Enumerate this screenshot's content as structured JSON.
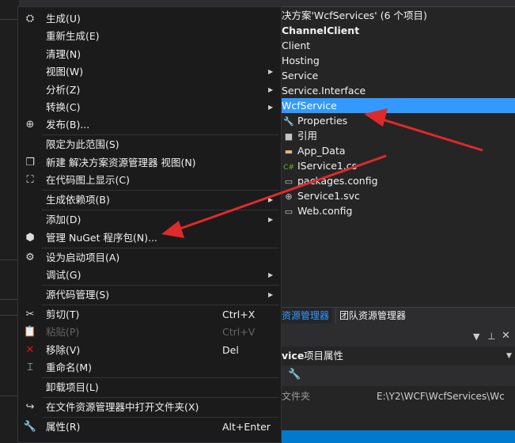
{
  "solution_explorer": {
    "items": [
      {
        "text": "决方案'WcfServices' (6 个项目)",
        "icon": "",
        "bold": false,
        "selected": false,
        "indent": 52
      },
      {
        "text": "ChannelClient",
        "icon": "",
        "bold": true,
        "selected": false,
        "indent": 52
      },
      {
        "text": "Client",
        "icon": "",
        "bold": false,
        "selected": false,
        "indent": 52
      },
      {
        "text": "Hosting",
        "icon": "",
        "bold": false,
        "selected": false,
        "indent": 52
      },
      {
        "text": "Service",
        "icon": "",
        "bold": false,
        "selected": false,
        "indent": 52
      },
      {
        "text": "Service.Interface",
        "icon": "",
        "bold": false,
        "selected": false,
        "indent": 52
      },
      {
        "text": "WcfService",
        "icon": "",
        "bold": false,
        "selected": true,
        "indent": 52
      },
      {
        "text": "Properties",
        "icon": "wrench-icon",
        "bold": false,
        "selected": false,
        "indent": 52
      },
      {
        "text": "引用",
        "icon": "references-icon",
        "bold": false,
        "selected": false,
        "indent": 52
      },
      {
        "text": "App_Data",
        "icon": "folder-icon",
        "bold": false,
        "selected": false,
        "indent": 52
      },
      {
        "text": "IService1.cs",
        "icon": "csharp-file-icon",
        "bold": false,
        "selected": false,
        "indent": 52
      },
      {
        "text": "packages.config",
        "icon": "config-file-icon",
        "bold": false,
        "selected": false,
        "indent": 52
      },
      {
        "text": "Service1.svc",
        "icon": "globe-icon",
        "bold": false,
        "selected": false,
        "indent": 52
      },
      {
        "text": "Web.config",
        "icon": "config-file-icon",
        "bold": false,
        "selected": false,
        "indent": 52
      }
    ],
    "tabs": {
      "active": "资源管理器",
      "inactive": "团队资源管理器"
    }
  },
  "properties": {
    "title_prefix": "vice",
    "title_suffix": "项目属性",
    "row_label": "文件夹",
    "row_value": "E:\\Y2\\WCF\\WcfServices\\Wc"
  },
  "menu": {
    "items": [
      {
        "label": "生成(U)",
        "icon": "build-icon",
        "shortcut": "",
        "submenu": false,
        "disabled": false,
        "sep_after": false
      },
      {
        "label": "重新生成(E)",
        "icon": "",
        "shortcut": "",
        "submenu": false,
        "disabled": false,
        "sep_after": false
      },
      {
        "label": "清理(N)",
        "icon": "",
        "shortcut": "",
        "submenu": false,
        "disabled": false,
        "sep_after": false
      },
      {
        "label": "视图(W)",
        "icon": "",
        "shortcut": "",
        "submenu": true,
        "disabled": false,
        "sep_after": false
      },
      {
        "label": "分析(Z)",
        "icon": "",
        "shortcut": "",
        "submenu": true,
        "disabled": false,
        "sep_after": false
      },
      {
        "label": "转换(C)",
        "icon": "",
        "shortcut": "",
        "submenu": true,
        "disabled": false,
        "sep_after": false
      },
      {
        "label": "发布(B)...",
        "icon": "publish-globe-icon",
        "shortcut": "",
        "submenu": false,
        "disabled": false,
        "sep_after": true
      },
      {
        "label": "限定为此范围(S)",
        "icon": "",
        "shortcut": "",
        "submenu": false,
        "disabled": false,
        "sep_after": false
      },
      {
        "label": "新建 解决方案资源管理器 视图(N)",
        "icon": "new-view-icon",
        "shortcut": "",
        "submenu": false,
        "disabled": false,
        "sep_after": false
      },
      {
        "label": "在代码图上显示(C)",
        "icon": "code-map-icon",
        "shortcut": "",
        "submenu": false,
        "disabled": false,
        "sep_after": true
      },
      {
        "label": "生成依赖项(B)",
        "icon": "",
        "shortcut": "",
        "submenu": true,
        "disabled": false,
        "sep_after": true
      },
      {
        "label": "添加(D)",
        "icon": "",
        "shortcut": "",
        "submenu": true,
        "disabled": false,
        "sep_after": false
      },
      {
        "label": "管理 NuGet 程序包(N)...",
        "icon": "nuget-icon",
        "shortcut": "",
        "submenu": false,
        "disabled": false,
        "sep_after": true
      },
      {
        "label": "设为启动项目(A)",
        "icon": "gear-icon",
        "shortcut": "",
        "submenu": false,
        "disabled": false,
        "sep_after": false
      },
      {
        "label": "调试(G)",
        "icon": "",
        "shortcut": "",
        "submenu": true,
        "disabled": false,
        "sep_after": true
      },
      {
        "label": "源代码管理(S)",
        "icon": "",
        "shortcut": "",
        "submenu": true,
        "disabled": false,
        "sep_after": true
      },
      {
        "label": "剪切(T)",
        "icon": "scissors-icon",
        "shortcut": "Ctrl+X",
        "submenu": false,
        "disabled": false,
        "sep_after": false
      },
      {
        "label": "粘贴(P)",
        "icon": "paste-icon",
        "shortcut": "Ctrl+V",
        "submenu": false,
        "disabled": true,
        "sep_after": false
      },
      {
        "label": "移除(V)",
        "icon": "remove-x-icon",
        "shortcut": "Del",
        "submenu": false,
        "disabled": false,
        "sep_after": false
      },
      {
        "label": "重命名(M)",
        "icon": "rename-icon",
        "shortcut": "",
        "submenu": false,
        "disabled": false,
        "sep_after": true
      },
      {
        "label": "卸载项目(L)",
        "icon": "",
        "shortcut": "",
        "submenu": false,
        "disabled": false,
        "sep_after": true
      },
      {
        "label": "在文件资源管理器中打开文件夹(X)",
        "icon": "open-folder-arrow-icon",
        "shortcut": "",
        "submenu": false,
        "disabled": false,
        "sep_after": true
      },
      {
        "label": "属性(R)",
        "icon": "wrench-icon",
        "shortcut": "Alt+Enter",
        "submenu": false,
        "disabled": false,
        "sep_after": false
      }
    ]
  },
  "colors": {
    "accent": "#3399ff",
    "menu_bg": "#1b1b1c",
    "arrow": "#e02a2a",
    "remove_icon": "#e51400"
  }
}
